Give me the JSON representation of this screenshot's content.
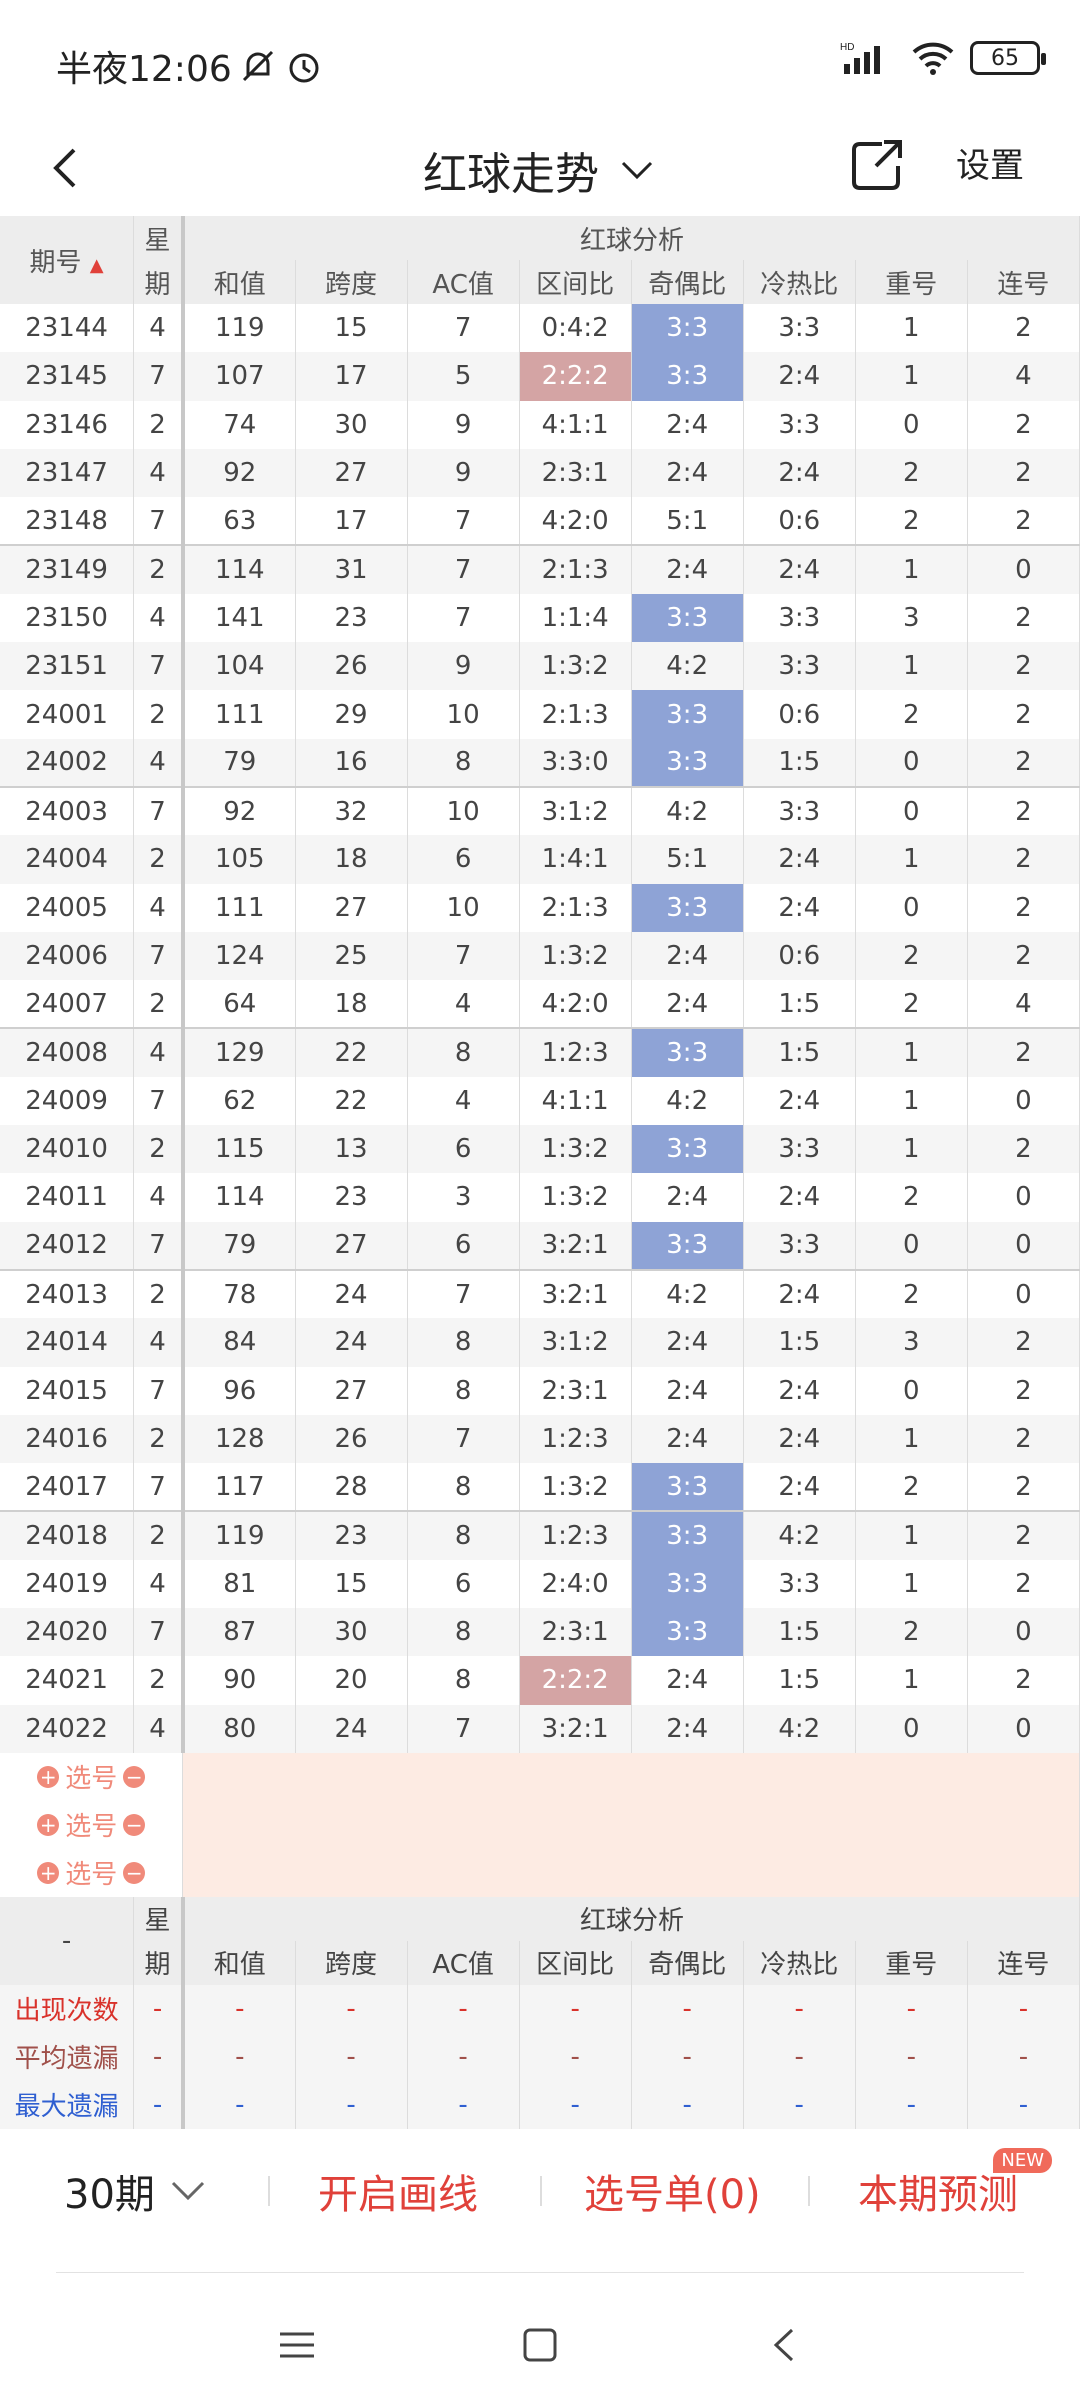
{
  "status": {
    "time": "半夜12:06",
    "battery": "65",
    "hd": "HD"
  },
  "header": {
    "title": "红球走势",
    "settings": "设置"
  },
  "table": {
    "col_period": "期号",
    "col_week_top": "星",
    "col_week_bottom": "期",
    "group_label": "红球分析",
    "columns": [
      "和值",
      "跨度",
      "AC值",
      "区间比",
      "奇偶比",
      "冷热比",
      "重号",
      "连号"
    ],
    "rows": [
      [
        "23144",
        "4",
        "119",
        "15",
        "7",
        "0:4:2",
        "3:3",
        "3:3",
        "1",
        "2"
      ],
      [
        "23145",
        "7",
        "107",
        "17",
        "5",
        "2:2:2",
        "3:3",
        "2:4",
        "1",
        "4"
      ],
      [
        "23146",
        "2",
        "74",
        "30",
        "9",
        "4:1:1",
        "2:4",
        "3:3",
        "0",
        "2"
      ],
      [
        "23147",
        "4",
        "92",
        "27",
        "9",
        "2:3:1",
        "2:4",
        "2:4",
        "2",
        "2"
      ],
      [
        "23148",
        "7",
        "63",
        "17",
        "7",
        "4:2:0",
        "5:1",
        "0:6",
        "2",
        "2"
      ],
      [
        "23149",
        "2",
        "114",
        "31",
        "7",
        "2:1:3",
        "2:4",
        "2:4",
        "1",
        "0"
      ],
      [
        "23150",
        "4",
        "141",
        "23",
        "7",
        "1:1:4",
        "3:3",
        "3:3",
        "3",
        "2"
      ],
      [
        "23151",
        "7",
        "104",
        "26",
        "9",
        "1:3:2",
        "4:2",
        "3:3",
        "1",
        "2"
      ],
      [
        "24001",
        "2",
        "111",
        "29",
        "10",
        "2:1:3",
        "3:3",
        "0:6",
        "2",
        "2"
      ],
      [
        "24002",
        "4",
        "79",
        "16",
        "8",
        "3:3:0",
        "3:3",
        "1:5",
        "0",
        "2"
      ],
      [
        "24003",
        "7",
        "92",
        "32",
        "10",
        "3:1:2",
        "4:2",
        "3:3",
        "0",
        "2"
      ],
      [
        "24004",
        "2",
        "105",
        "18",
        "6",
        "1:4:1",
        "5:1",
        "2:4",
        "1",
        "2"
      ],
      [
        "24005",
        "4",
        "111",
        "27",
        "10",
        "2:1:3",
        "3:3",
        "2:4",
        "0",
        "2"
      ],
      [
        "24006",
        "7",
        "124",
        "25",
        "7",
        "1:3:2",
        "2:4",
        "0:6",
        "2",
        "2"
      ],
      [
        "24007",
        "2",
        "64",
        "18",
        "4",
        "4:2:0",
        "2:4",
        "1:5",
        "2",
        "4"
      ],
      [
        "24008",
        "4",
        "129",
        "22",
        "8",
        "1:2:3",
        "3:3",
        "1:5",
        "1",
        "2"
      ],
      [
        "24009",
        "7",
        "62",
        "22",
        "4",
        "4:1:1",
        "4:2",
        "2:4",
        "1",
        "0"
      ],
      [
        "24010",
        "2",
        "115",
        "13",
        "6",
        "1:3:2",
        "3:3",
        "3:3",
        "1",
        "2"
      ],
      [
        "24011",
        "4",
        "114",
        "23",
        "3",
        "1:3:2",
        "2:4",
        "2:4",
        "2",
        "0"
      ],
      [
        "24012",
        "7",
        "79",
        "27",
        "6",
        "3:2:1",
        "3:3",
        "3:3",
        "0",
        "0"
      ],
      [
        "24013",
        "2",
        "78",
        "24",
        "7",
        "3:2:1",
        "4:2",
        "2:4",
        "2",
        "0"
      ],
      [
        "24014",
        "4",
        "84",
        "24",
        "8",
        "3:1:2",
        "2:4",
        "1:5",
        "3",
        "2"
      ],
      [
        "24015",
        "7",
        "96",
        "27",
        "8",
        "2:3:1",
        "2:4",
        "2:4",
        "0",
        "2"
      ],
      [
        "24016",
        "2",
        "128",
        "26",
        "7",
        "1:2:3",
        "2:4",
        "2:4",
        "1",
        "2"
      ],
      [
        "24017",
        "7",
        "117",
        "28",
        "8",
        "1:3:2",
        "3:3",
        "2:4",
        "2",
        "2"
      ],
      [
        "24018",
        "2",
        "119",
        "23",
        "8",
        "1:2:3",
        "3:3",
        "4:2",
        "1",
        "2"
      ],
      [
        "24019",
        "4",
        "81",
        "15",
        "6",
        "2:4:0",
        "3:3",
        "3:3",
        "1",
        "2"
      ],
      [
        "24020",
        "7",
        "87",
        "30",
        "8",
        "2:3:1",
        "3:3",
        "1:5",
        "2",
        "0"
      ],
      [
        "24021",
        "2",
        "90",
        "20",
        "8",
        "2:2:2",
        "2:4",
        "1:5",
        "1",
        "2"
      ],
      [
        "24022",
        "4",
        "80",
        "24",
        "7",
        "3:2:1",
        "2:4",
        "4:2",
        "0",
        "0"
      ]
    ],
    "pick_label": "选号",
    "stats_corner": "-",
    "stats": [
      {
        "label": "出现次数",
        "values": [
          "-",
          "-",
          "-",
          "-",
          "-",
          "-",
          "-",
          "-",
          "-"
        ]
      },
      {
        "label": "平均遗漏",
        "values": [
          "-",
          "-",
          "-",
          "-",
          "-",
          "-",
          "-",
          "-",
          "-"
        ]
      },
      {
        "label": "最大遗漏",
        "values": [
          "-",
          "-",
          "-",
          "-",
          "-",
          "-",
          "-",
          "-",
          "-"
        ]
      }
    ]
  },
  "bottom": {
    "period": "30期",
    "draw_lines": "开启画线",
    "pick_list": "选号单(0)",
    "predict": "本期预测",
    "new_badge": "NEW"
  },
  "colors": {
    "odd_even_highlight": "#8ea3d6",
    "zone_highlight": "#d4a4a4",
    "accent_red": "#e0413a"
  }
}
